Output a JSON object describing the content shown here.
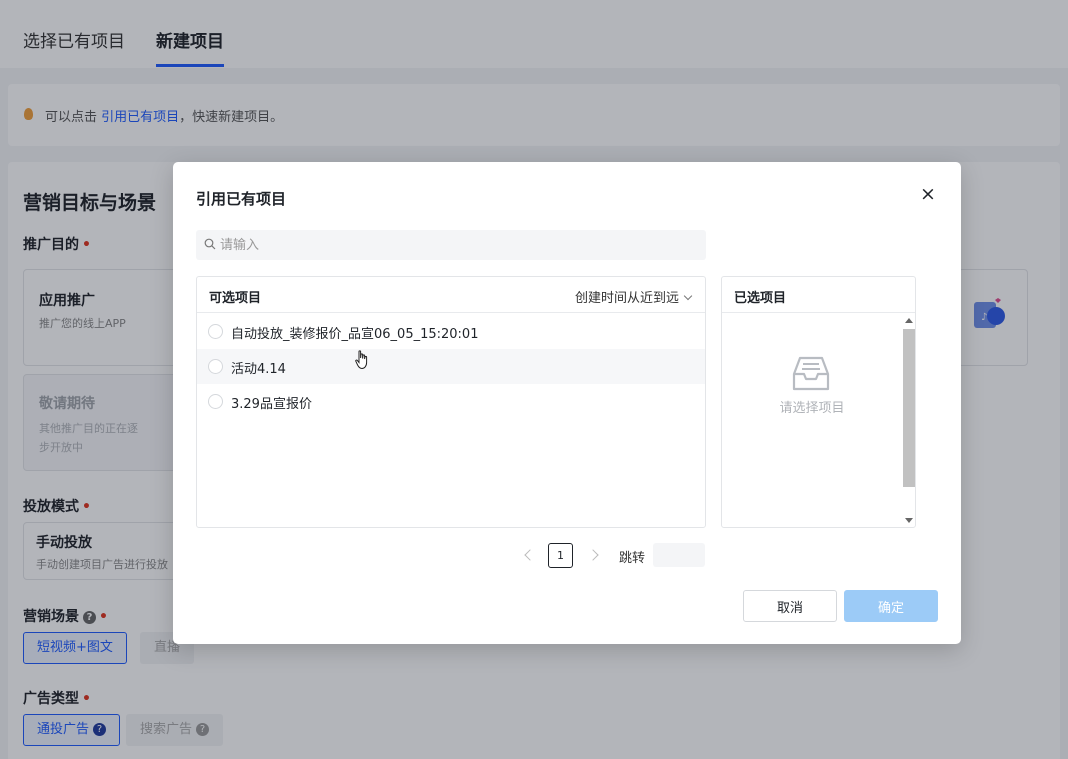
{
  "tabs": [
    {
      "label": "选择已有项目"
    },
    {
      "label": "新建项目"
    }
  ],
  "tip": {
    "prefix": "可以点击",
    "link": "引用已有项目",
    "suffix": "，快速新建项目。"
  },
  "section": {
    "title": "营销目标与场景",
    "purpose_label": "推广目的",
    "required_mark": "•",
    "cards": [
      {
        "title": "应用推广",
        "sub": "推广您的线上APP"
      },
      {
        "title": "敬请期待",
        "sub1": "其他推广目的正在逐",
        "sub2": "步开放中"
      }
    ],
    "mode_label": "投放模式",
    "mode_card": {
      "title": "手动投放",
      "sub": "手动创建项目广告进行投放"
    },
    "scene_label": "营销场景",
    "scenes": [
      "短视频+图文",
      "直播"
    ],
    "adtype_label": "广告类型",
    "adtypes": [
      "通投广告",
      "搜索广告"
    ],
    "help": "?"
  },
  "modal": {
    "title": "引用已有项目",
    "close": "×",
    "search_placeholder": "请输入",
    "list_title": "可选项目",
    "sort_label": "创建时间从近到远",
    "items": [
      {
        "label": "自动投放_装修报价_品宣06_05_15:20:01"
      },
      {
        "label": "活动4.14"
      },
      {
        "label": "3.29品宣报价"
      }
    ],
    "selected_title": "已选项目",
    "empty_text": "请选择项目",
    "pager": {
      "current": "1",
      "jump_label": "跳转"
    },
    "cancel": "取消",
    "ok": "确定"
  },
  "colors": {
    "accent": "#1f5cff",
    "ok_disabled": "#9ccbf7",
    "required": "#e0341e"
  }
}
